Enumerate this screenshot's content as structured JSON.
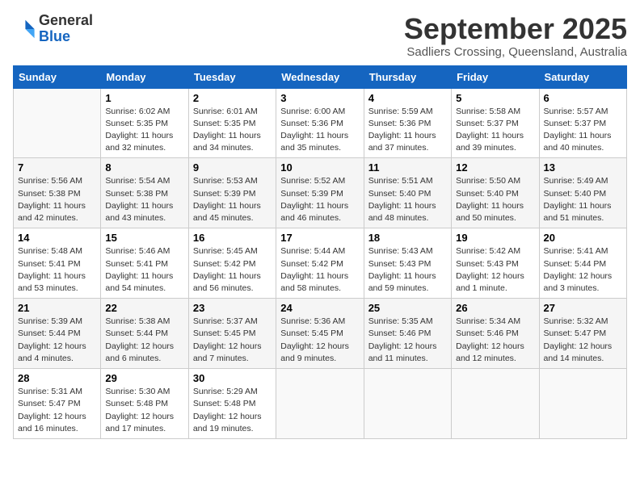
{
  "header": {
    "logo_general": "General",
    "logo_blue": "Blue",
    "month": "September 2025",
    "location": "Sadliers Crossing, Queensland, Australia"
  },
  "days_of_week": [
    "Sunday",
    "Monday",
    "Tuesday",
    "Wednesday",
    "Thursday",
    "Friday",
    "Saturday"
  ],
  "weeks": [
    [
      {
        "day": "",
        "content": ""
      },
      {
        "day": "1",
        "content": "Sunrise: 6:02 AM\nSunset: 5:35 PM\nDaylight: 11 hours\nand 32 minutes."
      },
      {
        "day": "2",
        "content": "Sunrise: 6:01 AM\nSunset: 5:35 PM\nDaylight: 11 hours\nand 34 minutes."
      },
      {
        "day": "3",
        "content": "Sunrise: 6:00 AM\nSunset: 5:36 PM\nDaylight: 11 hours\nand 35 minutes."
      },
      {
        "day": "4",
        "content": "Sunrise: 5:59 AM\nSunset: 5:36 PM\nDaylight: 11 hours\nand 37 minutes."
      },
      {
        "day": "5",
        "content": "Sunrise: 5:58 AM\nSunset: 5:37 PM\nDaylight: 11 hours\nand 39 minutes."
      },
      {
        "day": "6",
        "content": "Sunrise: 5:57 AM\nSunset: 5:37 PM\nDaylight: 11 hours\nand 40 minutes."
      }
    ],
    [
      {
        "day": "7",
        "content": "Sunrise: 5:56 AM\nSunset: 5:38 PM\nDaylight: 11 hours\nand 42 minutes."
      },
      {
        "day": "8",
        "content": "Sunrise: 5:54 AM\nSunset: 5:38 PM\nDaylight: 11 hours\nand 43 minutes."
      },
      {
        "day": "9",
        "content": "Sunrise: 5:53 AM\nSunset: 5:39 PM\nDaylight: 11 hours\nand 45 minutes."
      },
      {
        "day": "10",
        "content": "Sunrise: 5:52 AM\nSunset: 5:39 PM\nDaylight: 11 hours\nand 46 minutes."
      },
      {
        "day": "11",
        "content": "Sunrise: 5:51 AM\nSunset: 5:40 PM\nDaylight: 11 hours\nand 48 minutes."
      },
      {
        "day": "12",
        "content": "Sunrise: 5:50 AM\nSunset: 5:40 PM\nDaylight: 11 hours\nand 50 minutes."
      },
      {
        "day": "13",
        "content": "Sunrise: 5:49 AM\nSunset: 5:40 PM\nDaylight: 11 hours\nand 51 minutes."
      }
    ],
    [
      {
        "day": "14",
        "content": "Sunrise: 5:48 AM\nSunset: 5:41 PM\nDaylight: 11 hours\nand 53 minutes."
      },
      {
        "day": "15",
        "content": "Sunrise: 5:46 AM\nSunset: 5:41 PM\nDaylight: 11 hours\nand 54 minutes."
      },
      {
        "day": "16",
        "content": "Sunrise: 5:45 AM\nSunset: 5:42 PM\nDaylight: 11 hours\nand 56 minutes."
      },
      {
        "day": "17",
        "content": "Sunrise: 5:44 AM\nSunset: 5:42 PM\nDaylight: 11 hours\nand 58 minutes."
      },
      {
        "day": "18",
        "content": "Sunrise: 5:43 AM\nSunset: 5:43 PM\nDaylight: 11 hours\nand 59 minutes."
      },
      {
        "day": "19",
        "content": "Sunrise: 5:42 AM\nSunset: 5:43 PM\nDaylight: 12 hours\nand 1 minute."
      },
      {
        "day": "20",
        "content": "Sunrise: 5:41 AM\nSunset: 5:44 PM\nDaylight: 12 hours\nand 3 minutes."
      }
    ],
    [
      {
        "day": "21",
        "content": "Sunrise: 5:39 AM\nSunset: 5:44 PM\nDaylight: 12 hours\nand 4 minutes."
      },
      {
        "day": "22",
        "content": "Sunrise: 5:38 AM\nSunset: 5:44 PM\nDaylight: 12 hours\nand 6 minutes."
      },
      {
        "day": "23",
        "content": "Sunrise: 5:37 AM\nSunset: 5:45 PM\nDaylight: 12 hours\nand 7 minutes."
      },
      {
        "day": "24",
        "content": "Sunrise: 5:36 AM\nSunset: 5:45 PM\nDaylight: 12 hours\nand 9 minutes."
      },
      {
        "day": "25",
        "content": "Sunrise: 5:35 AM\nSunset: 5:46 PM\nDaylight: 12 hours\nand 11 minutes."
      },
      {
        "day": "26",
        "content": "Sunrise: 5:34 AM\nSunset: 5:46 PM\nDaylight: 12 hours\nand 12 minutes."
      },
      {
        "day": "27",
        "content": "Sunrise: 5:32 AM\nSunset: 5:47 PM\nDaylight: 12 hours\nand 14 minutes."
      }
    ],
    [
      {
        "day": "28",
        "content": "Sunrise: 5:31 AM\nSunset: 5:47 PM\nDaylight: 12 hours\nand 16 minutes."
      },
      {
        "day": "29",
        "content": "Sunrise: 5:30 AM\nSunset: 5:48 PM\nDaylight: 12 hours\nand 17 minutes."
      },
      {
        "day": "30",
        "content": "Sunrise: 5:29 AM\nSunset: 5:48 PM\nDaylight: 12 hours\nand 19 minutes."
      },
      {
        "day": "",
        "content": ""
      },
      {
        "day": "",
        "content": ""
      },
      {
        "day": "",
        "content": ""
      },
      {
        "day": "",
        "content": ""
      }
    ]
  ]
}
